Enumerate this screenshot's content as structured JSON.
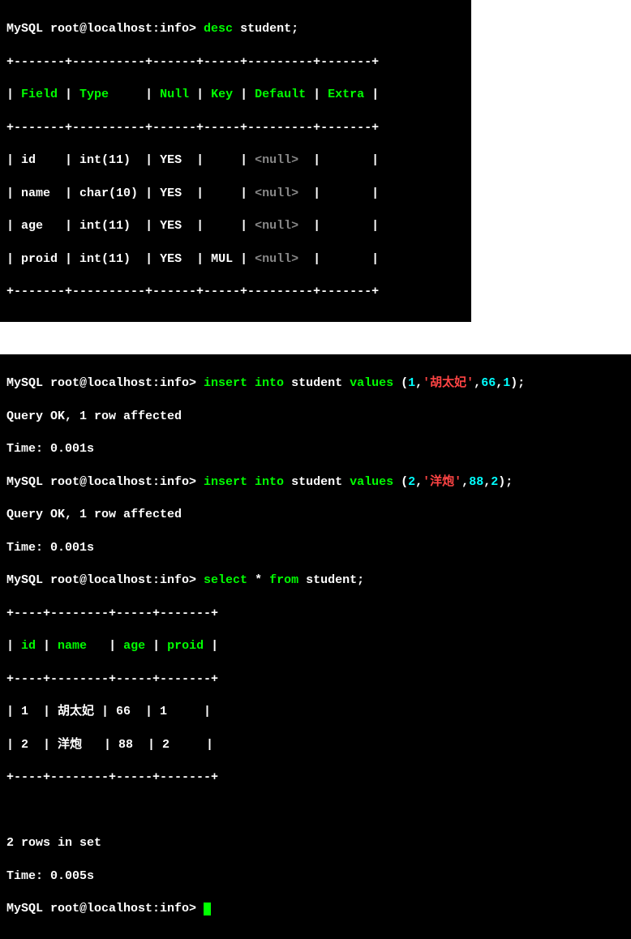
{
  "prompt1": {
    "prefix": "MySQL root@localhost:info> ",
    "cmd_kw": "desc",
    "cmd_rest": " student;"
  },
  "desc_table": {
    "border_top": "+-------+----------+------+-----+---------+-------+",
    "header": "| Field | Type     | Null | Key | Default | Extra |",
    "border_mid": "+-------+----------+------+-----+---------+-------+",
    "row1": {
      "field": "id",
      "type": "int(11)",
      "null": "YES",
      "key": "",
      "default": "<null>",
      "extra": ""
    },
    "row2": {
      "field": "name",
      "type": "char(10)",
      "null": "YES",
      "key": "",
      "default": "<null>",
      "extra": ""
    },
    "row3": {
      "field": "age",
      "type": "int(11)",
      "null": "YES",
      "key": "",
      "default": "<null>",
      "extra": ""
    },
    "row4": {
      "field": "proid",
      "type": "int(11)",
      "null": "YES",
      "key": "MUL",
      "default": "<null>",
      "extra": ""
    },
    "border_bot": "+-------+----------+------+-----+---------+-------+"
  },
  "insert1": {
    "prefix": "MySQL root@localhost:info> ",
    "kw1": "insert into",
    "tbl": " student ",
    "kw2": "values",
    "paren_open": " (",
    "v1": "1",
    "comma1": ",",
    "str": "'胡太妃'",
    "comma2": ",",
    "v3": "66",
    "comma3": ",",
    "v4": "1",
    "paren_close": ");"
  },
  "result1": {
    "line1": "Query OK, 1 row affected",
    "line2": "Time: 0.001s"
  },
  "insert2": {
    "prefix": "MySQL root@localhost:info> ",
    "kw1": "insert into",
    "tbl": " student ",
    "kw2": "values",
    "paren_open": " (",
    "v1": "2",
    "comma1": ",",
    "str": "'洋炮'",
    "comma2": ",",
    "v3": "88",
    "comma3": ",",
    "v4": "2",
    "paren_close": ");"
  },
  "result2": {
    "line1": "Query OK, 1 row affected",
    "line2": "Time: 0.001s"
  },
  "select1": {
    "prefix": "MySQL root@localhost:info> ",
    "kw1": "select",
    "star": " * ",
    "kw2": "from",
    "rest": " student;"
  },
  "select_table": {
    "border_top": "+----+--------+-----+-------+",
    "header": "| id | name   | age | proid |",
    "border_mid": "+----+--------+-----+-------+",
    "row1": "| 1  | 胡太妃 | 66  | 1     |",
    "row2": "| 2  | 洋炮   | 88  | 2     |",
    "border_bot": "+----+--------+-----+-------+"
  },
  "result3": {
    "line1": "2 rows in set",
    "line2": "Time: 0.005s"
  },
  "prompt_final": {
    "prefix": "MySQL root@localhost:info> "
  },
  "hdr_labels": {
    "field": "Field",
    "type": "Type",
    "null": "Null",
    "key": "Key",
    "default": "Default",
    "extra": "Extra",
    "id": "id",
    "name": "name",
    "age": "age",
    "proid": "proid"
  }
}
